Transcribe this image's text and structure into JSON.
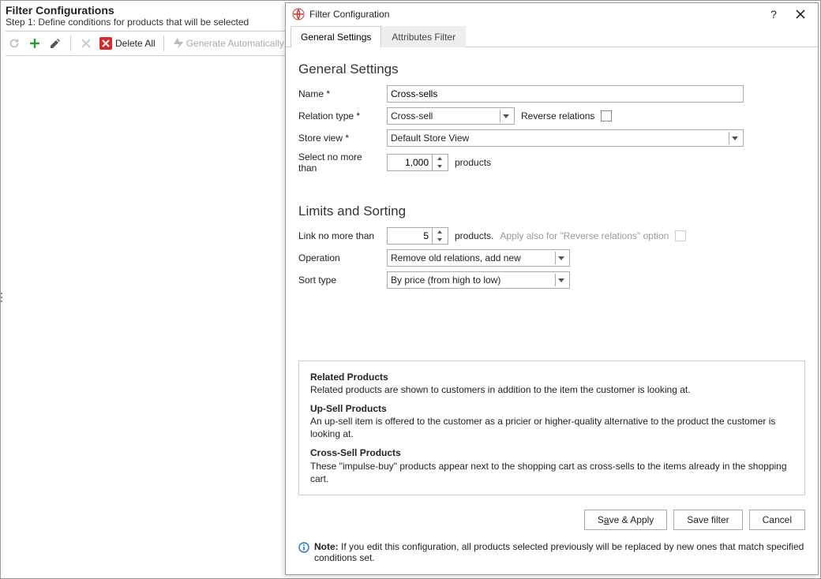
{
  "bg": {
    "title": "Filter Configurations",
    "subtitle": "Step 1: Define conditions for products that will be selected",
    "delete_all": "Delete All",
    "generate_auto": "Generate Automatically",
    "add_config": "Add Configuration"
  },
  "dialog": {
    "title": "Filter Configuration",
    "help": "?",
    "tabs": {
      "general": "General Settings",
      "attributes": "Attributes Filter"
    },
    "section_general": "General Settings",
    "fields": {
      "name_label": "Name *",
      "name_value": "Cross-sells",
      "relation_label": "Relation type *",
      "relation_value": "Cross-sell",
      "reverse_label": "Reverse relations",
      "storeview_label": "Store view *",
      "storeview_value": "Default Store View",
      "select_no_more_label": "Select no more than",
      "select_no_more_value": "1,000",
      "products_word": "products"
    },
    "section_limits": "Limits and Sorting",
    "limits": {
      "link_no_more_label": "Link no more than",
      "link_no_more_value": "5",
      "products_dot": "products.",
      "apply_also": "Apply also for \"Reverse relations\" option",
      "operation_label": "Operation",
      "operation_value": "Remove old relations, add new",
      "sort_label": "Sort type",
      "sort_value": "By price (from high to low)"
    },
    "info": {
      "related_t": "Related Products",
      "related_d": "Related products are shown to customers in addition to the item the customer is looking at.",
      "upsell_t": "Up-Sell Products",
      "upsell_d": "An up-sell item is offered to the customer as a pricier or higher-quality alternative to the product the customer is looking at.",
      "cross_t": "Cross-Sell Products",
      "cross_d": "These \"impulse-buy\" products appear next to the shopping cart as cross-sells to the items already in the shopping cart."
    },
    "buttons": {
      "save_apply_pre": "S",
      "save_apply_u": "a",
      "save_apply_post": "ve & Apply",
      "save_filter": "Save filter",
      "cancel": "Cancel"
    },
    "note_label": "Note:",
    "note_text": " If you edit this configuration, all products selected previously will be replaced by new ones that match specified conditions set."
  }
}
